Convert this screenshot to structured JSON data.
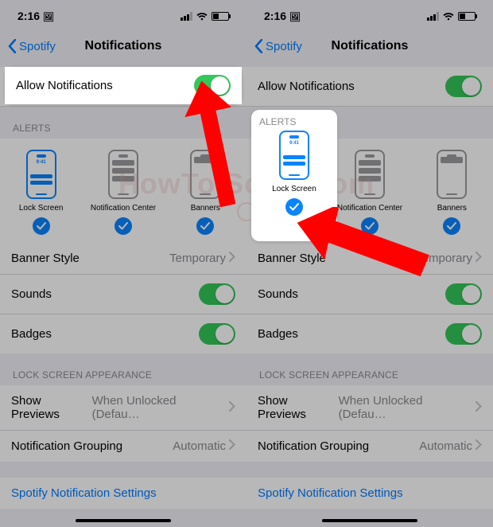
{
  "status": {
    "time": "2:16",
    "icon_after_time": "🖼"
  },
  "nav": {
    "back_label": "Spotify",
    "title": "Notifications"
  },
  "allow": {
    "label": "Allow Notifications"
  },
  "alerts": {
    "header": "ALERTS",
    "lock": "Lock Screen",
    "center": "Notification Center",
    "banners": "Banners",
    "lock_time": "9:41"
  },
  "rows": {
    "banner_style": {
      "label": "Banner Style",
      "value": "Temporary"
    },
    "sounds": "Sounds",
    "badges": "Badges"
  },
  "lsa": {
    "header": "LOCK SCREEN APPEARANCE",
    "show_previews": {
      "label": "Show Previews",
      "value": "When Unlocked (Defau…"
    },
    "grouping": {
      "label": "Notification Grouping",
      "value": "Automatic"
    }
  },
  "link": "Spotify Notification Settings",
  "watermark": "HowToISolve.com"
}
